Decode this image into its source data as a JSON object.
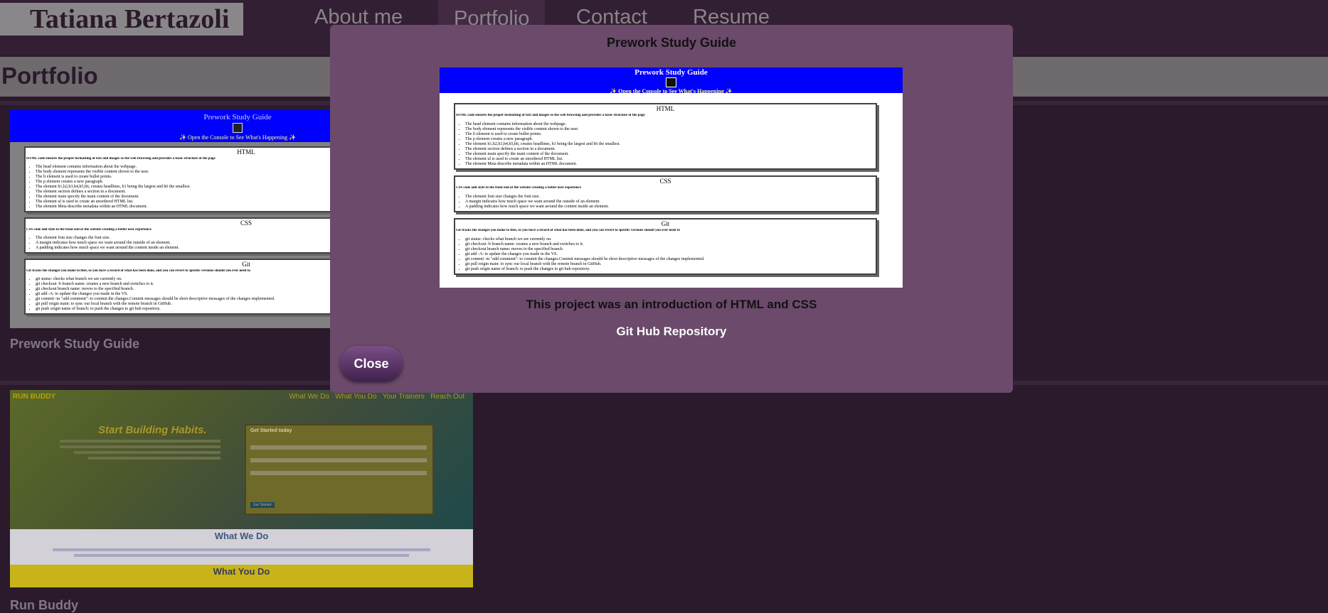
{
  "header": {
    "logo": "Tatiana Bertazoli",
    "nav": [
      "About me",
      "Portfolio",
      "Contact",
      "Resume"
    ]
  },
  "page": {
    "title": "Portfolio"
  },
  "projects": [
    {
      "title": "Prework Study Guide"
    },
    {
      "title": "Run Buddy"
    }
  ],
  "guide_preview": {
    "title": "Prework Study Guide",
    "subtitle": "✨ Open the Console to See What's Happening ✨",
    "sections": [
      {
        "heading": "HTML",
        "intro": "HTML code ensures the proper formatting of text and images so the web browsing and provides a basic structure of the page",
        "items": [
          "The head element contains information about the webpage.",
          "The body element represents the visible content shown to the user.",
          "The li element is used to create bullet points.",
          "The p element creates a new paragraph.",
          "The element h1,h2,h3,h4,h5,h6, creates headlines, h1 being the largest and h6 the smallest.",
          "The element section defines a section in a document.",
          "The element main specify the main content of the document.",
          "The element ul is used to create an unordered HTML list.",
          "The element Meta describe metadata within an HTML document."
        ]
      },
      {
        "heading": "CSS",
        "intro": "CSS code add style to the front end of the website creating a better user experience",
        "items": [
          "The element font size changes the font size.",
          "A margin indicates how much space we want around the outside of an element.",
          "A padding indicates how much space we want around the content inside an element."
        ]
      },
      {
        "heading": "Git",
        "intro": "Git tracks the changes you make to files, so you have a record of what has been done, and you can revert to specific versions should you ever need to",
        "items": [
          "git status: checks what branch we are currently on.",
          "git checkout -b branch name: creates a new branch and switches to it.",
          "git checkout branch name: moves to the specified branch.",
          "git add -A: to update the changes you made in the VS.",
          "git commit -m \"add comment\": to commit the changes.Commit messages should be short descriptive messages of the changes implemented.",
          "git pull origin main: to sync our local branch with the remote branch in GitHub.",
          "git push origin name of branch: to push the changes to git hub repository."
        ]
      }
    ]
  },
  "runbuddy_preview": {
    "brand": "RUN BUDDY",
    "nav": [
      "What We Do",
      "What You Do",
      "Your Trainers",
      "Reach Out"
    ],
    "headline": "Start Building Habits.",
    "form_title": "Get Started today",
    "form_button": "Get Started",
    "section1": "What We Do",
    "section2": "What You Do"
  },
  "modal": {
    "title": "Prework Study Guide",
    "description": "This project was an introduction of HTML and CSS",
    "link": "Git Hub Repository",
    "close": "Close"
  }
}
